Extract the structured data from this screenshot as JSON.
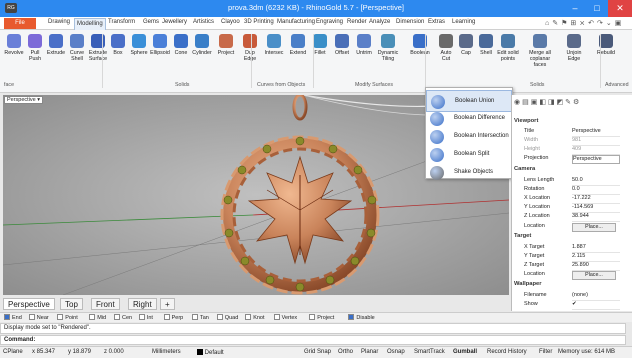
{
  "title": "prova.3dm (6232 KB) - RhinoGold 5.7 - [Perspective]",
  "app_icon_text": "RG",
  "window_controls": {
    "minimize": "–",
    "maximize": "□",
    "close": "✕"
  },
  "menu": {
    "file": "File",
    "items": [
      "Drawing",
      "Modelling",
      "Transform",
      "Gems",
      "Jewellery",
      "Artistics",
      "Clayoo",
      "3D Printing",
      "Manufacturing",
      "Engraving",
      "Render",
      "Analyze",
      "Dimension",
      "Extras",
      "Learning"
    ]
  },
  "ribbon": {
    "buttons": [
      {
        "label": "Revolve",
        "color": "#6a7fd8"
      },
      {
        "label": "Pull\nPush",
        "color": "#7c6ad8"
      },
      {
        "label": "Extrude",
        "color": "#4a6fc8"
      },
      {
        "label": "Curve\nShell",
        "color": "#5a7fc8"
      },
      {
        "label": "Extrude\nSurface",
        "color": "#3a5fb8"
      },
      {
        "label": "Box",
        "color": "#4a6fc8"
      },
      {
        "label": "Sphere",
        "color": "#3a8fd8"
      },
      {
        "label": "Ellipsoid",
        "color": "#4a7fd8"
      },
      {
        "label": "Cone",
        "color": "#3a6fc8"
      },
      {
        "label": "Cylinder",
        "color": "#3a7fc8"
      },
      {
        "label": "Project",
        "color": "#c86a4a"
      },
      {
        "label": "Dup\nEdge",
        "color": "#c85a3a"
      },
      {
        "label": "Intersec",
        "color": "#4a8fc8"
      },
      {
        "label": "Extend",
        "color": "#4a7fc8"
      },
      {
        "label": "Fillet",
        "color": "#3a8fc8"
      },
      {
        "label": "Offset",
        "color": "#4a6fb8"
      },
      {
        "label": "Untrim",
        "color": "#5a7fc8"
      },
      {
        "label": "Dynamic\nTiling",
        "color": "#4a8fb8"
      },
      {
        "label": "Boolean",
        "color": "#3a6fc8"
      },
      {
        "label": "Auto\nCut",
        "color": "#6a6a6a"
      },
      {
        "label": "Cap",
        "color": "#5a6a8a"
      },
      {
        "label": "Shell",
        "color": "#4a6a9a"
      },
      {
        "label": "Edit solid\npoints",
        "color": "#4a7aa8"
      },
      {
        "label": "Merge all\ncoplanar faces",
        "color": "#5a7aa8"
      },
      {
        "label": "Unjoin\nEdge",
        "color": "#5a6a8a"
      },
      {
        "label": "Rebuild",
        "color": "#4a5a7a"
      }
    ],
    "groups": [
      "face",
      "Solids",
      "Curves from Objects",
      "Modify Surfaces",
      "Solids",
      "Advanced"
    ]
  },
  "boolean_menu": {
    "items": [
      {
        "label": "Boolean Union",
        "color": "#3a6fc8"
      },
      {
        "label": "Boolean Difference",
        "color": "#3a6fc8"
      },
      {
        "label": "Boolean Intersection",
        "color": "#3a6fc8"
      },
      {
        "label": "Boolean Split",
        "color": "#3a6fc8"
      },
      {
        "label": "Shake Objects",
        "color": "#666666"
      }
    ]
  },
  "viewport": {
    "label": "Perspective"
  },
  "viewport_tabs": [
    "Perspective",
    "Top",
    "Front",
    "Right"
  ],
  "add_tab": "+",
  "osnap": {
    "items": [
      {
        "label": "End",
        "checked": true
      },
      {
        "label": "Near",
        "checked": false
      },
      {
        "label": "Point",
        "checked": false
      },
      {
        "label": "Mid",
        "checked": false
      },
      {
        "label": "Cen",
        "checked": false
      },
      {
        "label": "Int",
        "checked": false
      },
      {
        "label": "Perp",
        "checked": false
      },
      {
        "label": "Tan",
        "checked": false
      },
      {
        "label": "Quad",
        "checked": false
      },
      {
        "label": "Knot",
        "checked": false
      },
      {
        "label": "Vertex",
        "checked": false
      },
      {
        "label": "Project",
        "checked": false
      },
      {
        "label": "Disable",
        "checked": true
      }
    ]
  },
  "command_history": "Display mode set to \"Rendered\".",
  "command_prompt": "Command:",
  "properties": {
    "viewport_header": "Viewport",
    "title_label": "Title",
    "title_value": "Perspective",
    "width_label": "Width",
    "width_value": "981",
    "height_label": "Height",
    "height_value": "409",
    "projection_label": "Projection",
    "projection_value": "Perspective",
    "camera_header": "Camera",
    "lens_label": "Lens Length",
    "lens_value": "50.0",
    "rotation_label": "Rotation",
    "rotation_value": "0.0",
    "xloc_label": "X Location",
    "xloc_value": "-17.222",
    "yloc_label": "Y Location",
    "yloc_value": "-114.569",
    "zloc_label": "Z Location",
    "zloc_value": "38.944",
    "location_label": "Location",
    "place_button": "Place...",
    "target_header": "Target",
    "xtarget_label": "X Target",
    "xtarget_value": "1.887",
    "ytarget_label": "Y Target",
    "ytarget_value": "2.115",
    "ztarget_label": "Z Target",
    "ztarget_value": "25.890",
    "tlocation_label": "Location",
    "tplace_button": "Place...",
    "wallpaper_header": "Wallpaper",
    "filename_label": "Filename",
    "filename_value": "(none)",
    "show_label": "Show",
    "show_value": "✔"
  },
  "status": {
    "cplane": "CPlane",
    "x": "x 85.347",
    "y": "y 18.879",
    "z": "z 0.000",
    "units": "Millimeters",
    "layer": "Default",
    "toggles": [
      "Grid Snap",
      "Ortho",
      "Planar",
      "Osnap",
      "SmartTrack",
      "Gumball",
      "Record History",
      "Filter"
    ],
    "memory": "Memory use: 614 MB"
  },
  "colors": {
    "accent": "#2d89ef",
    "file_tab": "#e85a2e",
    "pendant": "#c9835a",
    "gem": "#8a8a2a",
    "viewport_bg": "#a9a9a9"
  }
}
